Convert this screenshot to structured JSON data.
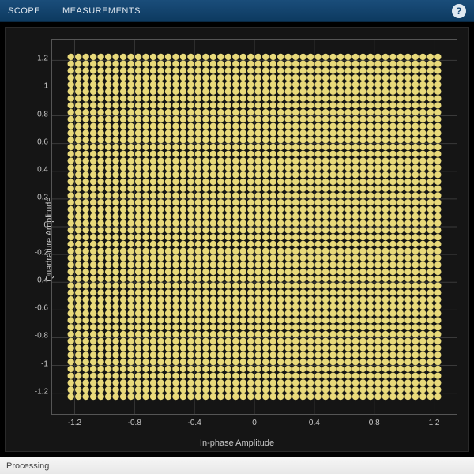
{
  "toolbar": {
    "scope_label": "SCOPE",
    "measurements_label": "MEASUREMENTS",
    "help_tooltip": "Help"
  },
  "statusbar": {
    "text": "Processing"
  },
  "chart_data": {
    "type": "scatter",
    "title": "",
    "xlabel": "In-phase Amplitude",
    "ylabel": "Quadrature Amplitude",
    "xlim": [
      -1.35,
      1.35
    ],
    "ylim": [
      -1.35,
      1.35
    ],
    "xticks": [
      -1.2,
      -0.8,
      -0.4,
      0,
      0.4,
      0.8,
      1.2
    ],
    "yticks": [
      -1.2,
      -1,
      -0.8,
      -0.6,
      -0.4,
      -0.2,
      0,
      0.2,
      0.4,
      0.6,
      0.8,
      1,
      1.2
    ],
    "grid": true,
    "marker_color": "#e8d97a",
    "marker_radius": 4.2,
    "series": [
      {
        "name": "constellation",
        "pattern": "grid",
        "coords": [
          -1.225,
          -1.175,
          -1.125,
          -1.075,
          -1.025,
          -0.975,
          -0.925,
          -0.875,
          -0.825,
          -0.775,
          -0.725,
          -0.675,
          -0.625,
          -0.575,
          -0.525,
          -0.475,
          -0.425,
          -0.375,
          -0.325,
          -0.275,
          -0.225,
          -0.175,
          -0.125,
          -0.075,
          -0.025,
          0.025,
          0.075,
          0.125,
          0.175,
          0.225,
          0.275,
          0.325,
          0.375,
          0.425,
          0.475,
          0.525,
          0.575,
          0.625,
          0.675,
          0.725,
          0.775,
          0.825,
          0.875,
          0.925,
          0.975,
          1.025,
          1.075,
          1.125,
          1.175,
          1.225
        ]
      }
    ]
  },
  "colors": {
    "toolbar_bg": "#134a75",
    "plot_bg": "#151515",
    "grid": "#3a3a3a",
    "axis_text": "#c8c8c8"
  }
}
